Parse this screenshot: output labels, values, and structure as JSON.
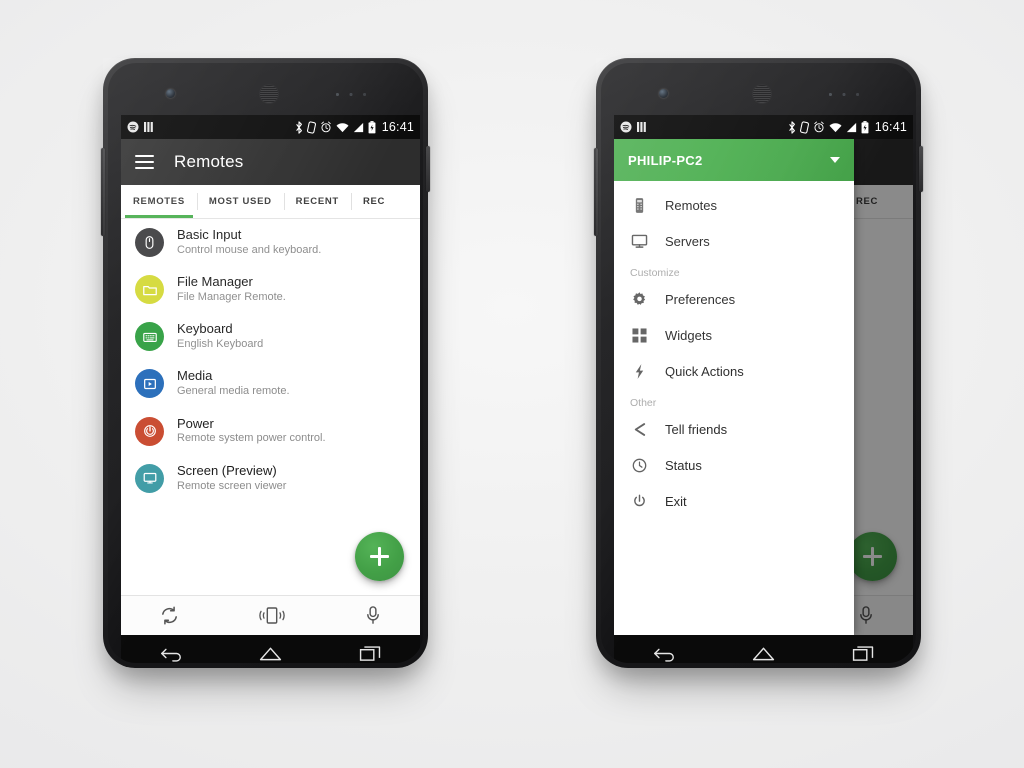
{
  "background_color": "#efefef",
  "theme": {
    "green": "#4caf50",
    "fab_green": "#43a047",
    "appbar_dark": "#2d2d2d",
    "statusbar_black": "#0c0c0c"
  },
  "statusbar": {
    "time": "16:41",
    "left_icons": [
      "spotify-icon",
      "equalizer-icon"
    ],
    "right_icons": [
      "bluetooth-icon",
      "rotation-lock-icon",
      "alarm-icon",
      "wifi-icon",
      "signal-icon",
      "battery-icon"
    ]
  },
  "left_phone": {
    "appbar": {
      "menu_icon": "hamburger-icon",
      "title": "Remotes"
    },
    "tabs": [
      {
        "label": "REMOTES",
        "active": true
      },
      {
        "label": "MOST USED",
        "active": false
      },
      {
        "label": "RECENT",
        "active": false
      },
      {
        "label": "REC",
        "active": false
      }
    ],
    "remotes": [
      {
        "title": "Basic Input",
        "subtitle": "Control mouse and keyboard.",
        "icon": "mouse-icon",
        "color": "#3f3f41"
      },
      {
        "title": "File Manager",
        "subtitle": "File Manager Remote.",
        "icon": "folder-icon",
        "color": "#d4d937"
      },
      {
        "title": "Keyboard",
        "subtitle": "English Keyboard",
        "icon": "keyboard-icon",
        "color": "#2e9e3f"
      },
      {
        "title": "Media",
        "subtitle": "General media remote.",
        "icon": "media-icon",
        "color": "#2269b8"
      },
      {
        "title": "Power",
        "subtitle": "Remote system power control.",
        "icon": "power-icon",
        "color": "#c8462a"
      },
      {
        "title": "Screen (Preview)",
        "subtitle": "Remote screen viewer",
        "icon": "monitor-icon",
        "color": "#3c9aa4"
      }
    ],
    "fab": {
      "label": "+",
      "name": "add-remote-fab"
    },
    "bottombar": [
      {
        "icon": "sync-icon",
        "name": "sync-button"
      },
      {
        "icon": "vibrate-icon",
        "name": "vibrate-button"
      },
      {
        "icon": "mic-icon",
        "name": "voice-button"
      }
    ],
    "navbar": [
      {
        "icon": "back-icon",
        "name": "nav-back"
      },
      {
        "icon": "home-icon",
        "name": "nav-home"
      },
      {
        "icon": "recents-icon",
        "name": "nav-recents"
      }
    ]
  },
  "right_phone": {
    "drawer": {
      "header": {
        "title": "PHILIP-PC2",
        "caret": "chevron-down-icon"
      },
      "items": [
        {
          "label": "Remotes",
          "icon": "remote-control-icon",
          "type": "item"
        },
        {
          "label": "Servers",
          "icon": "monitor-icon",
          "type": "item"
        },
        {
          "label": "Customize",
          "icon": null,
          "type": "section"
        },
        {
          "label": "Preferences",
          "icon": "gear-icon",
          "type": "item"
        },
        {
          "label": "Widgets",
          "icon": "widgets-icon",
          "type": "item"
        },
        {
          "label": "Quick Actions",
          "icon": "lightning-icon",
          "type": "item"
        },
        {
          "label": "Other",
          "icon": null,
          "type": "section"
        },
        {
          "label": "Tell friends",
          "icon": "share-icon",
          "type": "item"
        },
        {
          "label": "Status",
          "icon": "clock-icon",
          "type": "item"
        },
        {
          "label": "Exit",
          "icon": "power-off-icon",
          "type": "item"
        }
      ]
    },
    "background_tab": "REC",
    "fab": {
      "label": "+",
      "name": "add-remote-fab"
    }
  }
}
